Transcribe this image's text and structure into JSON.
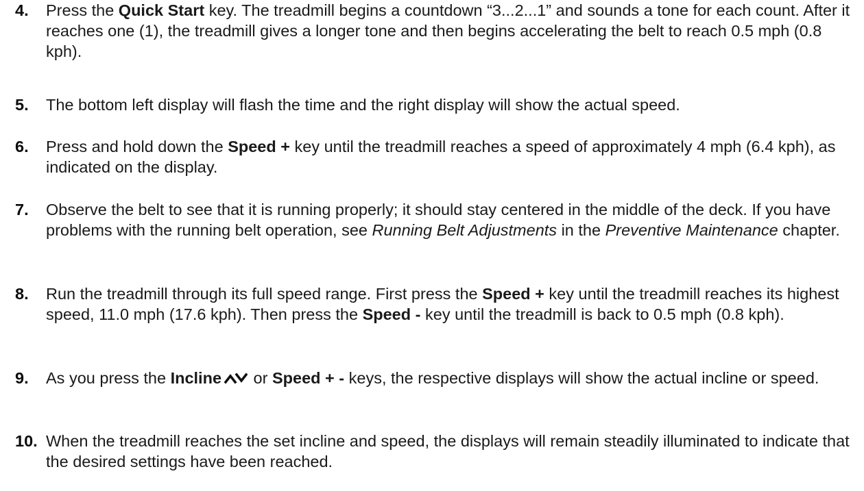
{
  "steps": [
    {
      "number": "4.",
      "parts": [
        "Press the ",
        "Quick Start",
        " key. The treadmill begins a countdown “3...2...1” and sounds a tone for each count. After it reaches one (1), the treadmill gives a longer tone and then begins accelerating the belt to reach 0.5 mph (0.8 kph)."
      ]
    },
    {
      "number": "5.",
      "parts": [
        "The bottom left display will flash the time and the right display will show the actual speed."
      ]
    },
    {
      "number": "6.",
      "parts": [
        "Press and hold down the ",
        "Speed +",
        " key until the treadmill reaches a speed of approximately 4 mph (6.4 kph), as indicated on the display."
      ]
    },
    {
      "number": "7.",
      "parts": [
        "Observe the belt to see that it is running properly; it should stay centered in the middle of the deck. If you have problems with the running belt operation, see ",
        "Running Belt Adjustments",
        " in the ",
        "Preventive Maintenance",
        " chapter."
      ]
    },
    {
      "number": "8.",
      "parts": [
        "Run the treadmill through its full speed range. First press the ",
        "Speed +",
        " key until the treadmill reaches its highest speed, 11.0 mph (17.6 kph). Then press the ",
        "Speed -",
        " key until the treadmill is back to 0.5 mph (0.8 kph)."
      ]
    },
    {
      "number": "9.",
      "parts": [
        "As you press the ",
        "Incline",
        " or ",
        "Speed + -",
        " keys, the respective displays will show the actual incline or speed."
      ],
      "icon": "incline-up-down-chevrons-icon"
    },
    {
      "number": "10.",
      "parts": [
        "When the treadmill reaches the set incline and speed, the displays will remain steadily illuminated to indicate that the desired settings have been reached."
      ]
    }
  ]
}
